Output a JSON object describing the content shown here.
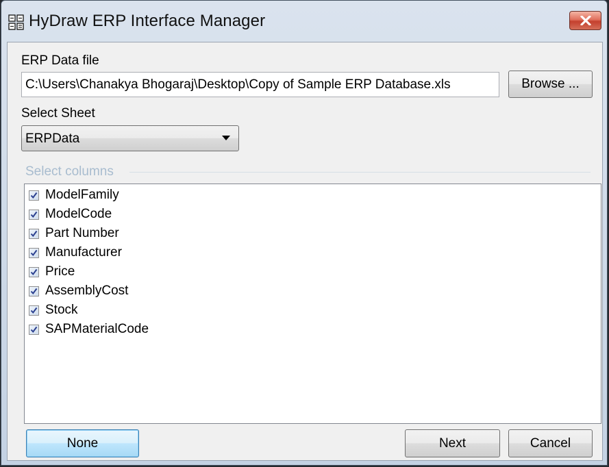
{
  "window": {
    "title": "HyDraw ERP Interface Manager",
    "icon": "app-grid-icon",
    "close_icon": "close-icon"
  },
  "form": {
    "erp_file_label": "ERP Data file",
    "erp_file_value": "C:\\Users\\Chanakya Bhogaraj\\Desktop\\Copy of Sample ERP Database.xls",
    "browse_label": "Browse ...",
    "select_sheet_label": "Select Sheet",
    "sheet_value": "ERPData",
    "select_columns_label": "Select columns"
  },
  "columns": [
    {
      "label": "ModelFamily",
      "checked": true
    },
    {
      "label": "ModelCode",
      "checked": true
    },
    {
      "label": "Part Number",
      "checked": true
    },
    {
      "label": "Manufacturer",
      "checked": true
    },
    {
      "label": "Price",
      "checked": true
    },
    {
      "label": "AssemblyCost",
      "checked": true
    },
    {
      "label": "Stock",
      "checked": true
    },
    {
      "label": "SAPMaterialCode",
      "checked": true
    }
  ],
  "buttons": {
    "none_label": "None",
    "next_label": "Next",
    "cancel_label": "Cancel"
  },
  "colors": {
    "group_label": "#a8bccf",
    "close_button": "#d0503c",
    "focus_border": "#3c7fb1"
  }
}
